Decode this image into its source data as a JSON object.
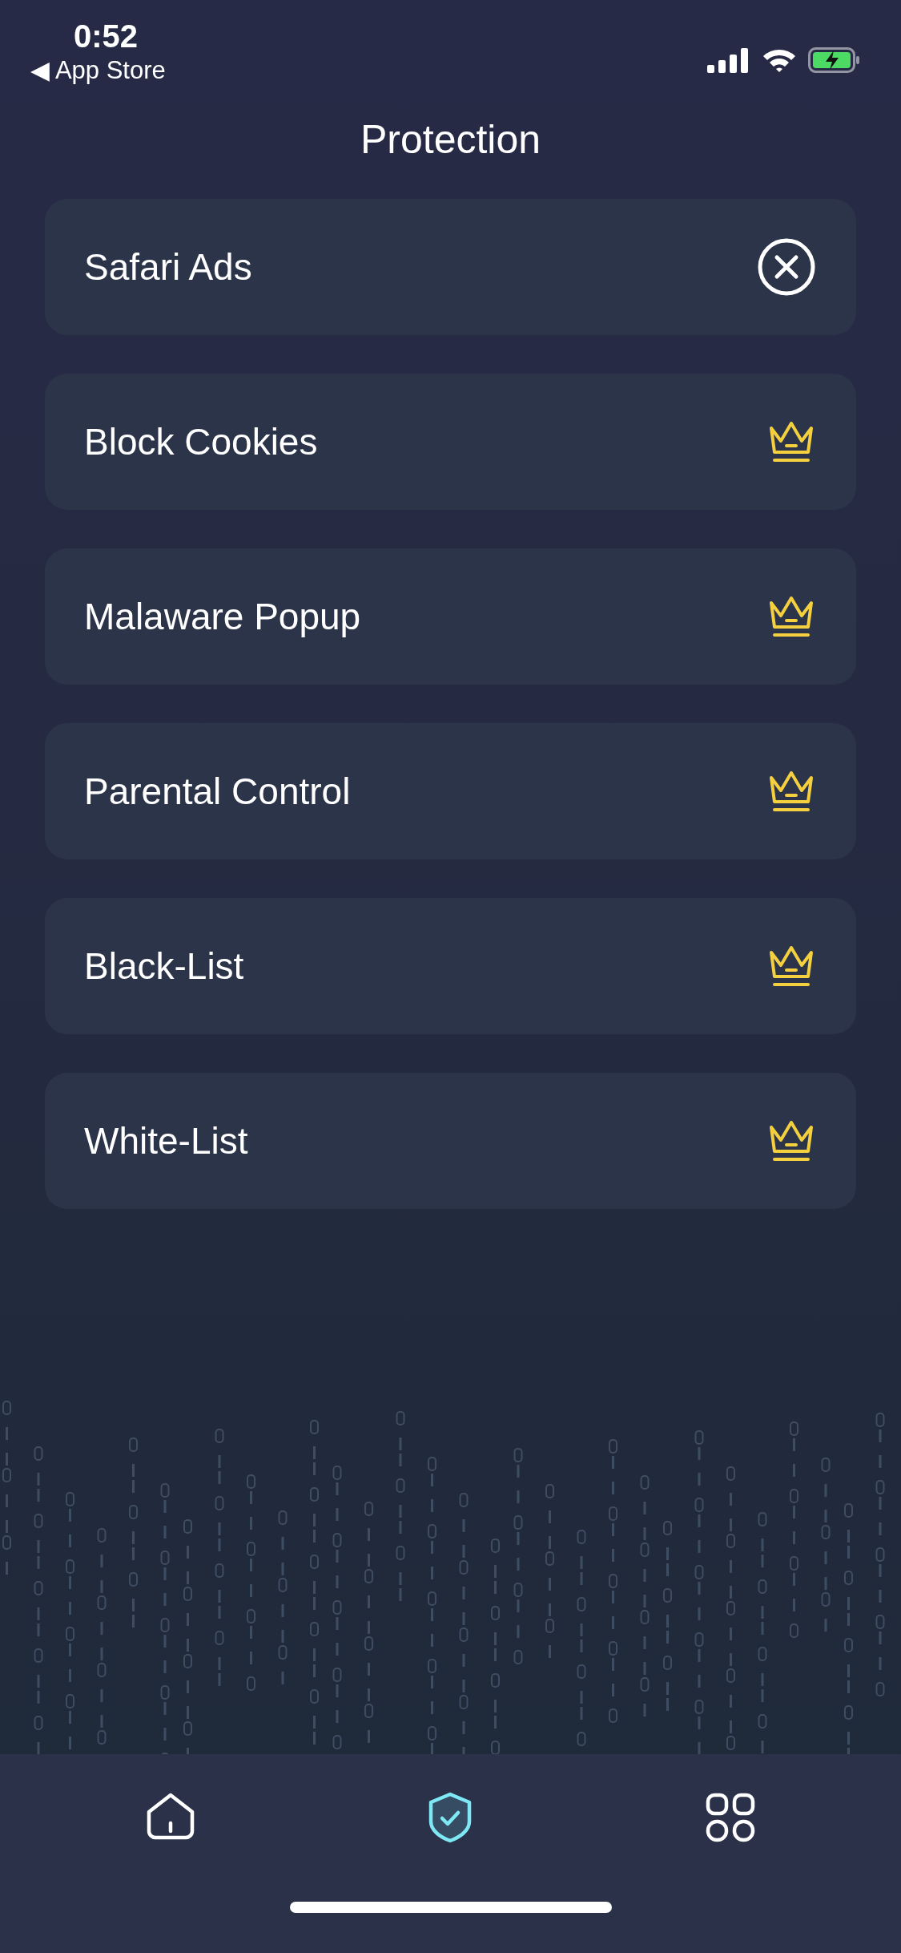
{
  "status_bar": {
    "time": "0:52",
    "back_label": "◀ App Store",
    "battery_charging": true
  },
  "title": "Protection",
  "rows": [
    {
      "label": "Safari Ads",
      "kind": "close"
    },
    {
      "label": "Block Cookies",
      "kind": "premium"
    },
    {
      "label": "Malaware Popup",
      "kind": "premium"
    },
    {
      "label": "Parental Control",
      "kind": "premium"
    },
    {
      "label": "Black-List",
      "kind": "premium"
    },
    {
      "label": "White-List",
      "kind": "premium"
    }
  ],
  "tabs": [
    {
      "kind": "home",
      "selected": false
    },
    {
      "kind": "shield",
      "selected": true
    },
    {
      "kind": "apps",
      "selected": false
    }
  ]
}
